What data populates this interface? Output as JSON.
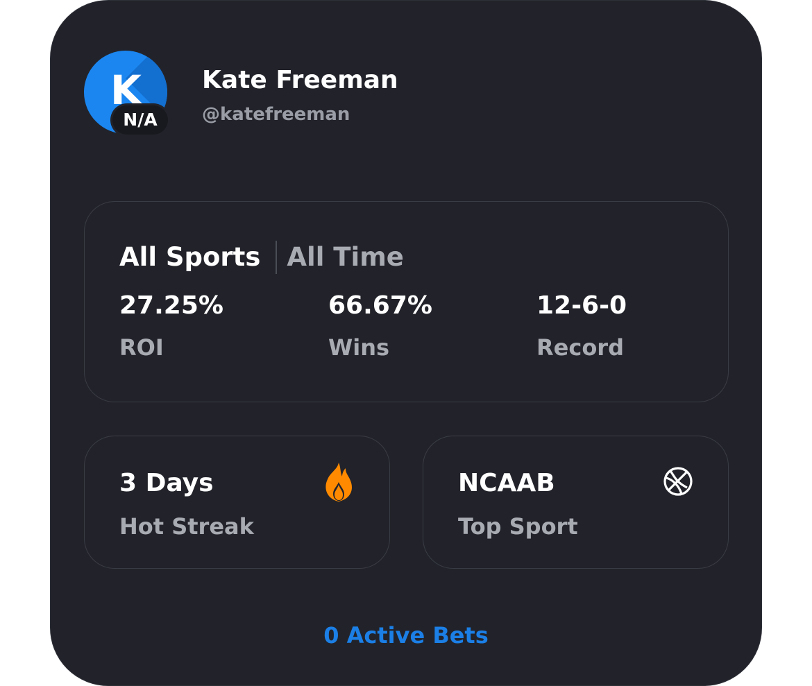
{
  "profile": {
    "avatar_initial": "K",
    "avatar_badge": "N/A",
    "name": "Kate Freeman",
    "handle": "@katefreeman"
  },
  "stats": {
    "sport_filter": "All Sports",
    "time_filter": "All Time",
    "items": [
      {
        "value": "27.25%",
        "label": "ROI"
      },
      {
        "value": "66.67%",
        "label": "Wins"
      },
      {
        "value": "12-6-0",
        "label": "Record"
      }
    ]
  },
  "streak": {
    "value": "3 Days",
    "label": "Hot Streak",
    "icon": "fire-icon"
  },
  "top_sport": {
    "value": "NCAAB",
    "label": "Top Sport",
    "icon": "basketball-icon"
  },
  "active_bets": "0 Active Bets",
  "colors": {
    "card_bg": "#22232a",
    "accent": "#1b7fe6",
    "avatar": "#1b86f0",
    "fire": "#ff8a00"
  }
}
